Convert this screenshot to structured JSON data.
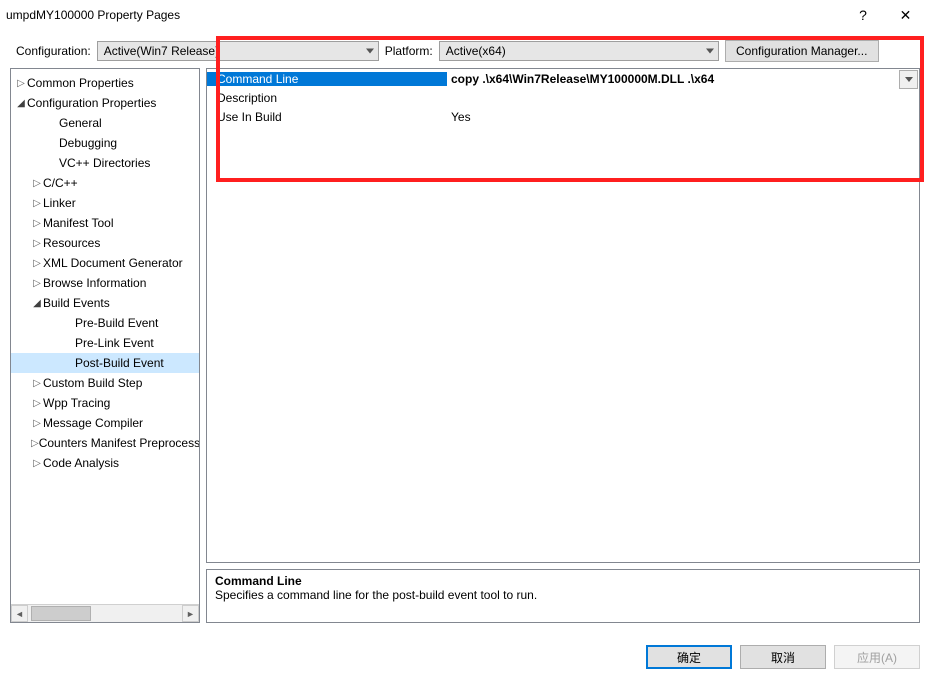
{
  "window": {
    "title": "umpdMY100000 Property Pages",
    "help_symbol": "?",
    "close_symbol": "✕"
  },
  "top": {
    "config_label": "Configuration:",
    "config_value": "Active(Win7 Release)",
    "platform_label": "Platform:",
    "platform_value": "Active(x64)",
    "config_mgr_label": "Configuration Manager..."
  },
  "tree": {
    "items": [
      {
        "indent": 0,
        "icon": "right",
        "label": "Common Properties"
      },
      {
        "indent": 0,
        "icon": "down",
        "label": "Configuration Properties"
      },
      {
        "indent": 2,
        "icon": "",
        "label": "General"
      },
      {
        "indent": 2,
        "icon": "",
        "label": "Debugging"
      },
      {
        "indent": 2,
        "icon": "",
        "label": "VC++ Directories"
      },
      {
        "indent": 1,
        "icon": "right",
        "label": "C/C++"
      },
      {
        "indent": 1,
        "icon": "right",
        "label": "Linker"
      },
      {
        "indent": 1,
        "icon": "right",
        "label": "Manifest Tool"
      },
      {
        "indent": 1,
        "icon": "right",
        "label": "Resources"
      },
      {
        "indent": 1,
        "icon": "right",
        "label": "XML Document Generator"
      },
      {
        "indent": 1,
        "icon": "right",
        "label": "Browse Information"
      },
      {
        "indent": 1,
        "icon": "down",
        "label": "Build Events"
      },
      {
        "indent": 3,
        "icon": "",
        "label": "Pre-Build Event"
      },
      {
        "indent": 3,
        "icon": "",
        "label": "Pre-Link Event"
      },
      {
        "indent": 3,
        "icon": "",
        "label": "Post-Build Event",
        "selected": true
      },
      {
        "indent": 1,
        "icon": "right",
        "label": "Custom Build Step"
      },
      {
        "indent": 1,
        "icon": "right",
        "label": "Wpp Tracing"
      },
      {
        "indent": 1,
        "icon": "right",
        "label": "Message Compiler"
      },
      {
        "indent": 1,
        "icon": "right",
        "label": "Counters Manifest Preprocessor"
      },
      {
        "indent": 1,
        "icon": "right",
        "label": "Code Analysis"
      }
    ]
  },
  "grid": {
    "rows": [
      {
        "name": "Command Line",
        "value": "copy .\\x64\\Win7Release\\MY100000M.DLL .\\x64",
        "selected": true,
        "bold": true
      },
      {
        "name": "Description",
        "value": "",
        "selected": false,
        "bold": false
      },
      {
        "name": "Use In Build",
        "value": "Yes",
        "selected": false,
        "bold": false
      }
    ]
  },
  "desc": {
    "title": "Command Line",
    "text": "Specifies a command line for the post-build event tool to run."
  },
  "buttons": {
    "ok": "确定",
    "cancel": "取消",
    "apply": "应用(A)"
  }
}
